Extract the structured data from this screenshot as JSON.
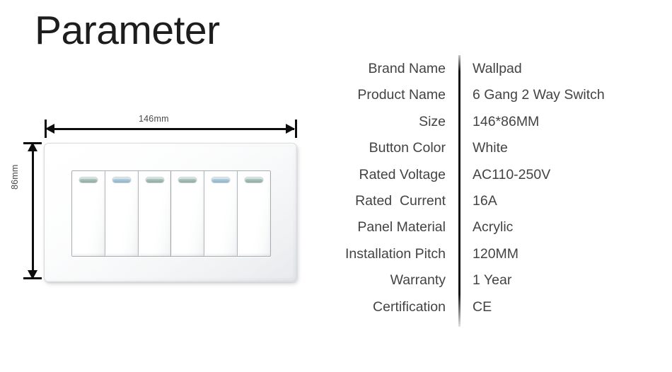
{
  "page": {
    "title": "Parameter"
  },
  "product_drawing": {
    "width_dimension_label": "146mm",
    "height_dimension_label": "86mm",
    "gang_count": 6,
    "indicator_tints": [
      "tint-green",
      "tint-blue",
      "tint-green",
      "tint-green",
      "tint-blue",
      "tint-green"
    ]
  },
  "spec_table": {
    "rows": [
      {
        "label": "Brand Name",
        "value": "Wallpad"
      },
      {
        "label": "Product Name",
        "value": "6 Gang 2 Way Switch"
      },
      {
        "label": "Size",
        "value": "146*86MM"
      },
      {
        "label": "Button Color",
        "value": "White"
      },
      {
        "label": "Rated Voltage",
        "value": "AC110-250V"
      },
      {
        "label": "Rated  Current",
        "value": "16A"
      },
      {
        "label": "Panel Material",
        "value": "Acrylic"
      },
      {
        "label": "Installation Pitch",
        "value": "120MM"
      },
      {
        "label": "Warranty",
        "value": "1 Year"
      },
      {
        "label": "Certification",
        "value": "CE"
      }
    ]
  },
  "colors": {
    "background": "#ffffff",
    "title_text": "#1d1d1d",
    "body_text": "#434343",
    "divider": "#141414",
    "dimension_line": "#0d0d0d",
    "indicator_teal": "#a8bfc4",
    "indicator_blue": "#a9c9dc"
  }
}
